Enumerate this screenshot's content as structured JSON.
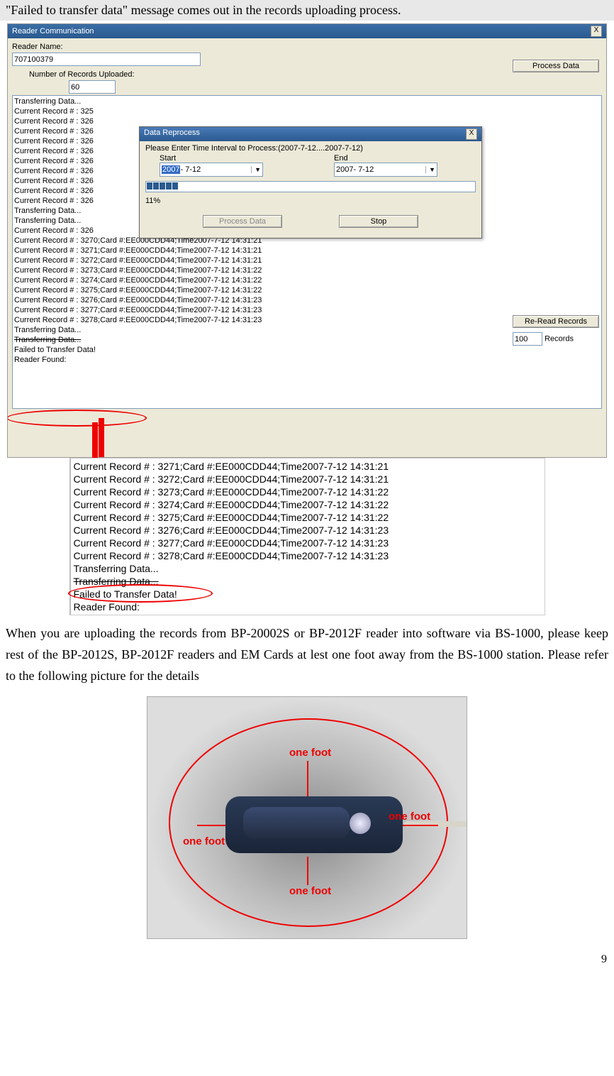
{
  "header": "\"Failed to transfer data\" message comes out in the records uploading process.",
  "win1": {
    "title": "Reader Communication",
    "close": "X",
    "reader_name_lbl": "Reader Name:",
    "reader_name_val": "707100379",
    "num_uploaded_lbl": "Number of Records Uploaded:",
    "num_uploaded_val": "60",
    "process_btn": "Process Data",
    "reread_btn": "Re-Read Records",
    "reread_val": "100",
    "reread_suffix": "Records",
    "log": [
      "Transferring Data...",
      "Current Record # :  325",
      "Current Record # :  326",
      "Current Record # :  326",
      "Current Record # :  326",
      "Current Record # :  326",
      "Current Record # :  326",
      "Current Record # :  326",
      "Current Record # :  326",
      "Current Record # :  326",
      "Current Record # :  326",
      "Transferring Data...",
      "Transferring Data...",
      "Current Record # :  326",
      "Current Record # :  3270;Card #:EE000CDD44;Time2007-7-12 14:31:21",
      "Current Record # :  3271;Card #:EE000CDD44;Time2007-7-12 14:31:21",
      "Current Record # :  3272;Card #:EE000CDD44;Time2007-7-12 14:31:21",
      "Current Record # :  3273;Card #:EE000CDD44;Time2007-7-12 14:31:22",
      "Current Record # :  3274;Card #:EE000CDD44;Time2007-7-12 14:31:22",
      "Current Record # :  3275;Card #:EE000CDD44;Time2007-7-12 14:31:22",
      "Current Record # :  3276;Card #:EE000CDD44;Time2007-7-12 14:31:23",
      "Current Record # :  3277;Card #:EE000CDD44;Time2007-7-12 14:31:23",
      "Current Record # :  3278;Card #:EE000CDD44;Time2007-7-12 14:31:23",
      "Transferring Data...",
      "Transferring Data...",
      "Failed to Transfer Data!",
      "Reader Found:"
    ]
  },
  "dlg": {
    "title": "Data Reprocess",
    "close": "X",
    "prompt": "Please Enter Time Interval to Process:(2007-7-12....2007-7-12)",
    "start_lbl": "Start",
    "end_lbl": "End",
    "start_sel": "2007",
    "start_rest": "- 7-12",
    "end_val": "2007- 7-12",
    "percent": "11%",
    "process_btn": "Process Data",
    "stop_btn": "Stop"
  },
  "zoom": {
    "lines": [
      "Current Record # :  3271;Card #:EE000CDD44;Time2007-7-12 14:31:21",
      "Current Record # :  3272;Card #:EE000CDD44;Time2007-7-12 14:31:21",
      "Current Record # :  3273;Card #:EE000CDD44;Time2007-7-12 14:31:22",
      "Current Record # :  3274;Card #:EE000CDD44;Time2007-7-12 14:31:22",
      "Current Record # :  3275;Card #:EE000CDD44;Time2007-7-12 14:31:22",
      "Current Record # :  3276;Card #:EE000CDD44;Time2007-7-12 14:31:23",
      "Current Record # :  3277;Card #:EE000CDD44;Time2007-7-12 14:31:23",
      "Current Record # :  3278;Card #:EE000CDD44;Time2007-7-12 14:31:23",
      "Transferring Data...",
      "Transferring Data...",
      "Failed to Transfer Data!",
      "Reader Found:"
    ]
  },
  "para": "When you are uploading the records from BP-20002S or BP-2012F reader into software via BS-1000, please keep rest of the BP-2012S, BP-2012F readers and EM Cards at lest one foot away from the BS-1000 station. Please refer to the following picture for the details",
  "photo_lbls": {
    "top": "one foot",
    "left": "one foot",
    "right": "one foot",
    "bottom": "one foot"
  },
  "page": "9"
}
